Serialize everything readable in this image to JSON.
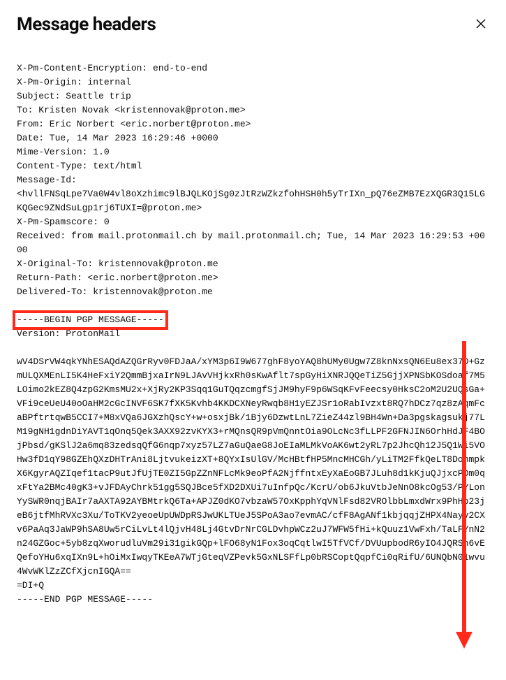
{
  "dialog": {
    "title": "Message headers"
  },
  "headers": {
    "x_pm_content_encryption": "X-Pm-Content-Encryption: end-to-end",
    "x_pm_origin": "X-Pm-Origin: internal",
    "subject": "Subject: Seattle trip",
    "to": "To: Kristen Novak <kristennovak@proton.me>",
    "from": "From: Eric Norbert <eric.norbert@proton.me>",
    "date": "Date: Tue, 14 Mar 2023 16:29:46 +0000",
    "mime_version": "Mime-Version: 1.0",
    "content_type": "Content-Type: text/html",
    "message_id_label": "Message-Id:",
    "message_id_value": "<hvllFNSqLpe7Va0W4vl8oXzhimc9lBJQLKOjSg0zJtRzWZkzfohHSH0h5yTrIXn_pQ76eZMB7EzXQGR3Q15LGKQGec9ZNdSuLgp1rj6TUXI=@proton.me>",
    "x_pm_spamscore": "X-Pm-Spamscore: 0",
    "received": "Received: from mail.protonmail.ch by mail.protonmail.ch; Tue, 14 Mar 2023 16:29:53 +0000",
    "x_original_to": "X-Original-To: kristennovak@proton.me",
    "return_path": "Return-Path: <eric.norbert@proton.me>",
    "delivered_to": "Delivered-To: kristennovak@proton.me"
  },
  "pgp": {
    "begin": "-----BEGIN PGP MESSAGE-----",
    "version": "Version: ProtonMail",
    "body": "wV4DSrVW4qkYNhESAQdAZQGrRyv0FDJaA/xYM3p6I9W677ghF8yoYAQ8hUMy0Ugw7Z8knNxsQN6Eu8ex37D+GzmULQXMEnLI5K4HeFxiY2QmmBjxaIrN9LJAvVHjkxRh0sKwAflt7spGyHiXNRJQQeTiZ5GjjXPNSbKOSdoaf7M5LOimo2kEZ8Q4zpG2KmsMU2x+XjRy2KP3Sqq1GuTQqzcmgfSjJM9hyF9p6WSqKFvFeecsy0HksC2oM2U2UQsGa+VFi9ceUeU40oOaHM2cGcINVF6SK7fXK5Kvhb4KKDCXNeyRwqb8H1yEZJSr1oRabIvzxt8RQ7hDCz7qz8zAqmFcaBPftrtqwB5CCI7+M8xVQa6JGXzhQscY+w+osxjBk/1Bjy6DzwtLnL7ZieZ44zl9BH4Wn+Da3pgskagsukj77LM19gNH1gdnDiYAVT1qOnq5Qek3AXX92zvKYX3+rMQnsQR9pVmQnntOia9OLcNc3fLLPF2GFNJIN6OrhHdJF4BOjPbsd/gKSlJ2a6mq83zedsqQfG6nqp7xyz57LZ7aGuQaeG8JoEIaMLMkVoAK6wt2yRL7p2JhcQh12J5Q1Wi5VOHw3fD1qY98GZEhQXzDHTrAni8LjtvukeizXT+8QYxIsUlGV/McHBtfHP5MncMHCGh/yLiTM2FfkQeLT8DonmpkX6KgyrAQZIqef1tacP9utJfUjTE0ZI5GpZZnNFLcMk9eoPfA2NjffntxEyXaEoGB7JLuh8d1kKjuQJjxcPDm0qxFtYa2BMc40gK3+vJFDAyChrk51gg5SQJBce5fXD2DXUi7uInfpQc/KcrU/ob6JkuVtbJeNnO8kcOg53/PYLonYySWR0nqjBAIr7aAXTA92AYBMtrkQ6Ta+APJZ0dKO7vbzaW57OxKpphYqVNlFsd82VROlbbLmxdWrx9PhHb23jeB6jtfMhRVXc3Xu/ToTKV2yeoeUpUWDpRSJwUKLTUeJ5SPoA3ao7evmAC/cfF8AgANf1kbjqqjZHPX4Nayv2CXv6PaAq3JaWP9hSA8Uw5rCiLvLt4lQjvH48Lj4GtvDrNrCGLDvhpWCz2uJ7WFW5fHi+kQuuz1VwFxh/TaLFYnN2n24GZGoc+5yb8zqXworudluVm29i31gikGQp+lFO68yN1Fox3oqCqtlwI5TfVCf/DVUupbodR6yIO4JQRSh6vEQefoYHu6xqIXn9L+hOiMxIwqyTKEeA7WTjGteqVZPevk5GxNLSFfLp0bRSCoptQqpfCi0qRifU/6UNQbN01wvu4WvWKlZzZCfXjcnIGQA==",
    "checksum": "=DI+Q",
    "end": "-----END PGP MESSAGE-----"
  }
}
